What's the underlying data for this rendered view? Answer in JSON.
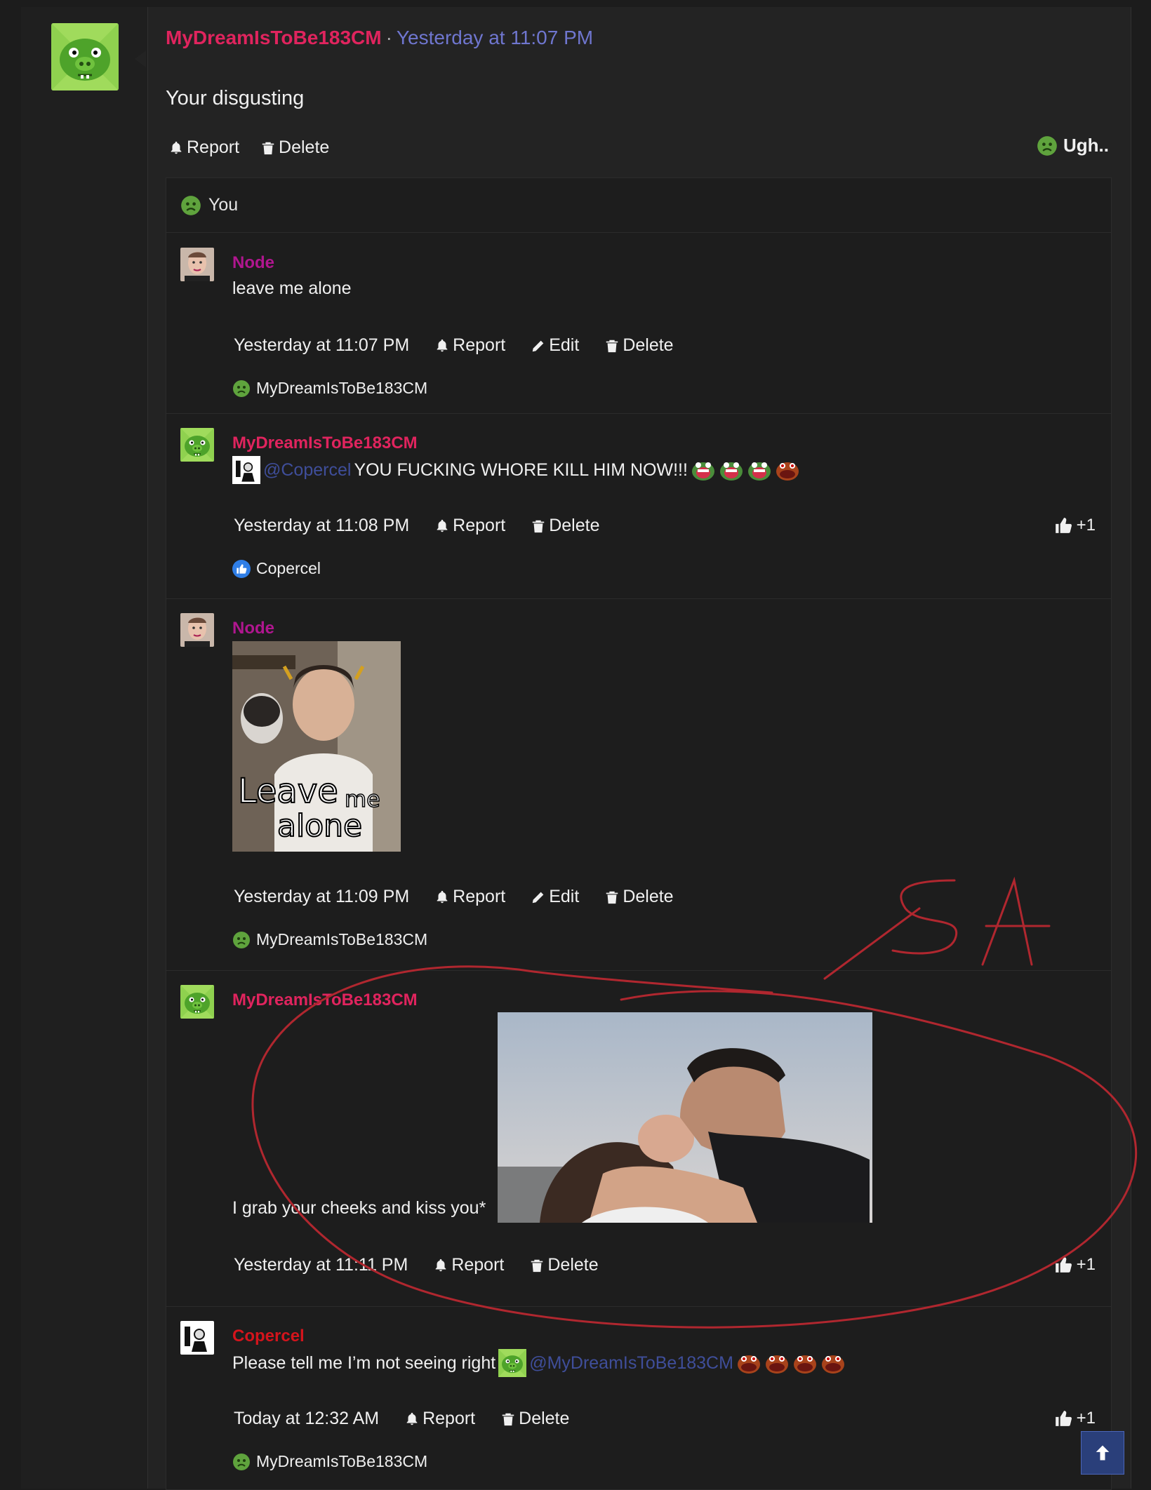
{
  "post": {
    "author": "MyDreamIsToBe183CM",
    "separator": "·",
    "time": "Yesterday at 11:07 PM",
    "body": "Your disgusting",
    "actions": {
      "report": "Report",
      "delete": "Delete"
    },
    "reaction_summary": "Ugh.."
  },
  "reactions_header": {
    "label": "You"
  },
  "comments": [
    {
      "author": "Node",
      "text": "leave me alone",
      "time": "Yesterday at 11:07 PM",
      "report": "Report",
      "edit": "Edit",
      "delete": "Delete",
      "reaction_user": "MyDreamIsToBe183CM"
    },
    {
      "author": "MyDreamIsToBe183CM",
      "mention": "@Copercel",
      "text": "YOU FUCKING WHORE KILL HIM NOW!!!",
      "time": "Yesterday at 11:08 PM",
      "report": "Report",
      "delete": "Delete",
      "like_count": "+1",
      "reaction_user": "Copercel"
    },
    {
      "author": "Node",
      "image_caption_1": "Leave",
      "image_caption_2": "me",
      "image_caption_3": "alone",
      "time": "Yesterday at 11:09 PM",
      "report": "Report",
      "edit": "Edit",
      "delete": "Delete",
      "reaction_user": "MyDreamIsToBe183CM"
    },
    {
      "author": "MyDreamIsToBe183CM",
      "text": "I grab your cheeks and kiss you*",
      "time": "Yesterday at 11:11 PM",
      "report": "Report",
      "delete": "Delete",
      "like_count": "+1"
    },
    {
      "author": "Copercel",
      "text": "Please tell me I’m not seeing right",
      "mention": "@MyDreamIsToBe183CM",
      "time": "Today at 12:32 AM",
      "report": "Report",
      "delete": "Delete",
      "like_count": "+1",
      "reaction_user": "MyDreamIsToBe183CM"
    }
  ],
  "annotation": {
    "text": "SA",
    "color": "#b0272f"
  },
  "colors": {
    "author_pink": "#e0245e",
    "author_purple": "#a21caf",
    "author_red": "#d4141c",
    "time_link": "#6f76cf",
    "mention": "#3f4e9a"
  }
}
